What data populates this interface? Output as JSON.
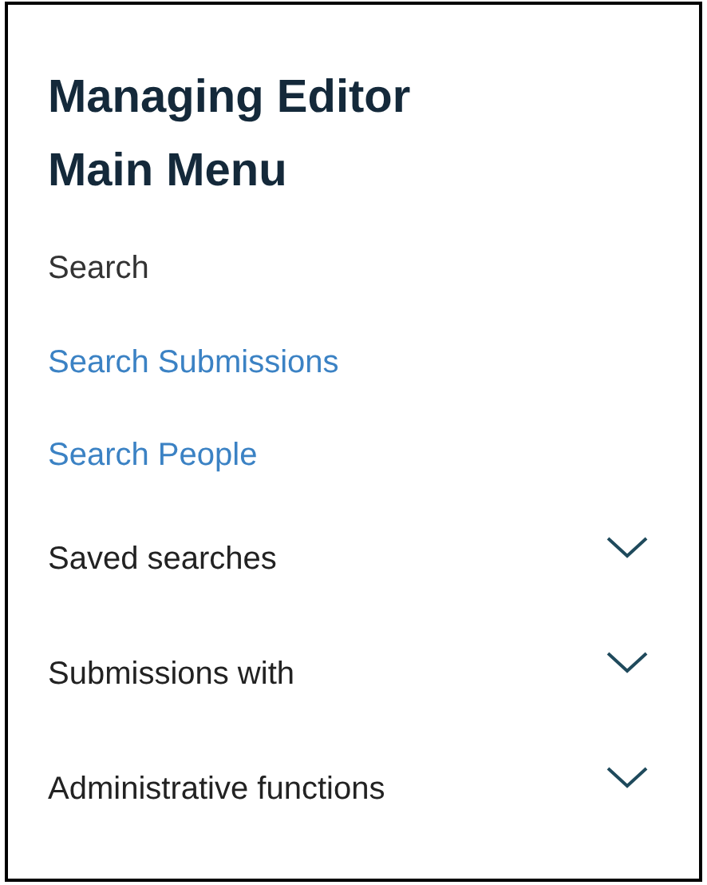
{
  "title": "Managing Editor Main Menu",
  "items": [
    {
      "kind": "label",
      "label": "Search"
    },
    {
      "kind": "link",
      "label": "Search Submissions"
    },
    {
      "kind": "link",
      "label": "Search People"
    },
    {
      "kind": "section",
      "label": "Saved searches",
      "expanded": false
    },
    {
      "kind": "section",
      "label": "Submissions with",
      "expanded": false
    },
    {
      "kind": "section",
      "label": "Administrative functions",
      "expanded": false
    }
  ]
}
